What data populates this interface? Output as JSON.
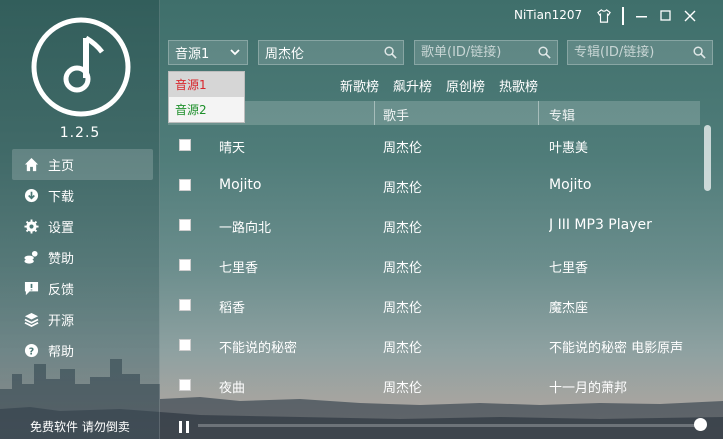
{
  "app": {
    "version": "1.2.5",
    "username": "NiTian1207",
    "footer_text": "免费软件 请勿倒卖"
  },
  "sidebar": {
    "items": [
      {
        "label": "主页",
        "icon": "home-icon",
        "active": true
      },
      {
        "label": "下载",
        "icon": "download-icon",
        "active": false
      },
      {
        "label": "设置",
        "icon": "gear-icon",
        "active": false
      },
      {
        "label": "赞助",
        "icon": "coins-icon",
        "active": false
      },
      {
        "label": "反馈",
        "icon": "feedback-icon",
        "active": false
      },
      {
        "label": "开源",
        "icon": "layers-icon",
        "active": false
      },
      {
        "label": "帮助",
        "icon": "help-icon",
        "active": false
      }
    ]
  },
  "window": {
    "icons": [
      "shirt-icon",
      "minimize-icon",
      "maximize-icon",
      "close-icon"
    ]
  },
  "search": {
    "source_selected": "音源1",
    "song_value": "周杰伦",
    "playlist_placeholder": "歌单(ID/链接)",
    "album_placeholder": "专辑(ID/链接)"
  },
  "dropdown": {
    "options": [
      "音源1",
      "音源2"
    ]
  },
  "charts": {
    "tabs": [
      "新歌榜",
      "飙升榜",
      "原创榜",
      "热歌榜"
    ]
  },
  "table": {
    "headers": [
      "歌手",
      "专辑"
    ],
    "rows": [
      {
        "title": "晴天",
        "artist": "周杰伦",
        "album": "叶惠美"
      },
      {
        "title": "Mojito",
        "artist": "周杰伦",
        "album": "Mojito"
      },
      {
        "title": "一路向北",
        "artist": "周杰伦",
        "album": "J III MP3 Player"
      },
      {
        "title": "七里香",
        "artist": "周杰伦",
        "album": "七里香"
      },
      {
        "title": "稻香",
        "artist": "周杰伦",
        "album": "魔杰座"
      },
      {
        "title": "不能说的秘密",
        "artist": "周杰伦",
        "album": "不能说的秘密 电影原声"
      },
      {
        "title": "夜曲",
        "artist": "周杰伦",
        "album": "十一月的萧邦"
      }
    ]
  },
  "colors": {
    "dropdown_option1": "#d8262b",
    "dropdown_option2": "#1d8f2a"
  }
}
